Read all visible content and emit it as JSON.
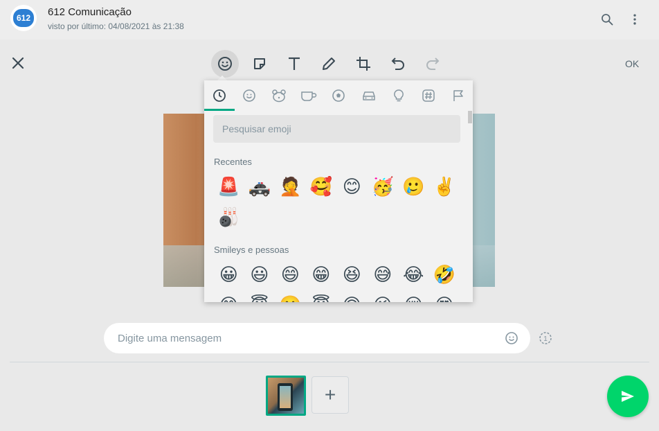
{
  "header": {
    "avatar_text": "612",
    "contact_name": "612 Comunicação",
    "last_seen": "visto por último: 04/08/2021 às 21:38",
    "icons": [
      "search-icon",
      "menu-icon"
    ]
  },
  "toolbar": {
    "tools": [
      "emoji-icon",
      "sticker-icon",
      "text-icon",
      "pencil-icon",
      "crop-icon",
      "undo-icon",
      "redo-icon"
    ],
    "active_tool": "emoji-icon",
    "ok_label": "OK"
  },
  "emoji_panel": {
    "categories": [
      "clock-icon",
      "smiley-icon",
      "bear-icon",
      "cup-icon",
      "ball-icon",
      "car-icon",
      "lightbulb-icon",
      "hash-icon",
      "flag-icon"
    ],
    "active_category": "clock-icon",
    "search_placeholder": "Pesquisar emoji",
    "recent_title": "Recentes",
    "recent_emojis": [
      "🚨",
      "🚓",
      "🤦",
      "🥰",
      "😊",
      "🥳",
      "🥲",
      "✌️",
      "🎳"
    ],
    "smileys_title": "Smileys e pessoas",
    "smiley_emojis": [
      "😀",
      "😃",
      "😄",
      "😁",
      "😆",
      "😅",
      "😂",
      "🤣",
      "😊",
      "😇",
      "🙂",
      "😇",
      "🙃",
      "😉",
      "😌",
      "😍"
    ]
  },
  "message": {
    "placeholder": "Digite uma mensagem",
    "view_once_label": "1"
  },
  "thumbnails": {
    "add_label": "+"
  },
  "colors": {
    "accent": "#00a884",
    "send": "#00d56b"
  }
}
